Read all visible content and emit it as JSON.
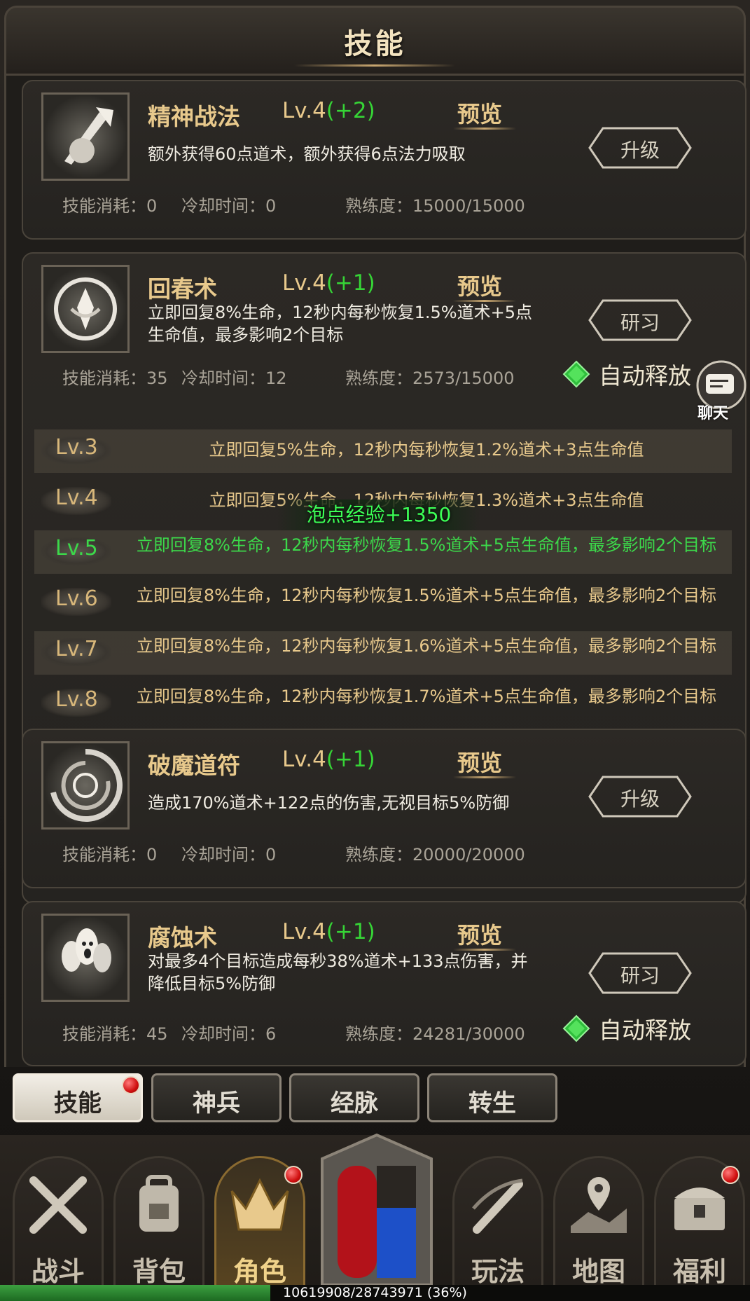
{
  "header": {
    "title": "技能"
  },
  "skills": [
    {
      "name": "精神战法",
      "level": "Lv.4",
      "bonus": "(+2)",
      "preview": "预览",
      "desc": "额外获得60点道术，额外获得6点法力吸取",
      "button": "升级",
      "cost_label": "技能消耗：0",
      "cooldown_label": "冷却时间：0",
      "mastery_label": "熟练度：15000/15000"
    },
    {
      "name": "回春术",
      "level": "Lv.4",
      "bonus": "(+1)",
      "preview": "预览",
      "desc": "立即回复8%生命，12秒内每秒恢复1.5%道术+5点生命值，最多影响2个目标",
      "button": "研习",
      "cost_label": "技能消耗：35",
      "cooldown_label": "冷却时间：12",
      "mastery_label": "熟练度：2573/15000",
      "auto_cast": "自动释放"
    },
    {
      "name": "破魔道符",
      "level": "Lv.4",
      "bonus": "(+1)",
      "preview": "预览",
      "desc": "造成170%道术+122点的伤害,无视目标5%防御",
      "button": "升级",
      "cost_label": "技能消耗：0",
      "cooldown_label": "冷却时间：0",
      "mastery_label": "熟练度：20000/20000"
    },
    {
      "name": "腐蚀术",
      "level": "Lv.4",
      "bonus": "(+1)",
      "preview": "预览",
      "desc": "对最多4个目标造成每秒38%道术+133点伤害，并降低目标5%防御",
      "button": "研习",
      "cost_label": "技能消耗：45",
      "cooldown_label": "冷却时间：6",
      "mastery_label": "熟练度：24281/30000",
      "auto_cast": "自动释放"
    }
  ],
  "level_rows": [
    {
      "lv": "Lv.3",
      "desc": "立即回复5%生命，12秒内每秒恢复1.2%道术+3点生命值"
    },
    {
      "lv": "Lv.4",
      "desc": "立即回复5%生命，12秒内每秒恢复1.3%道术+3点生命值"
    },
    {
      "lv": "Lv.5",
      "desc": "立即回复8%生命，12秒内每秒恢复1.5%道术+5点生命值，最多影响2个目标"
    },
    {
      "lv": "Lv.6",
      "desc": "立即回复8%生命，12秒内每秒恢复1.5%道术+5点生命值，最多影响2个目标"
    },
    {
      "lv": "Lv.7",
      "desc": "立即回复8%生命，12秒内每秒恢复1.6%道术+5点生命值，最多影响2个目标"
    },
    {
      "lv": "Lv.8",
      "desc": "立即回复8%生命，12秒内每秒恢复1.7%道术+5点生命值，最多影响2个目标"
    }
  ],
  "floating_text": "泡点经验+1350",
  "chat": {
    "label": "聊天"
  },
  "tabs": [
    "技能",
    "神兵",
    "经脉",
    "转生"
  ],
  "nav": [
    "战斗",
    "背包",
    "角色",
    "玩法",
    "地图",
    "福利"
  ],
  "exp": {
    "text": "10619908/28743971 (36%)",
    "fraction": 0.36
  },
  "colors": {
    "gold": "#e8c98c",
    "green": "#36d436",
    "panel": "#2c2925"
  }
}
